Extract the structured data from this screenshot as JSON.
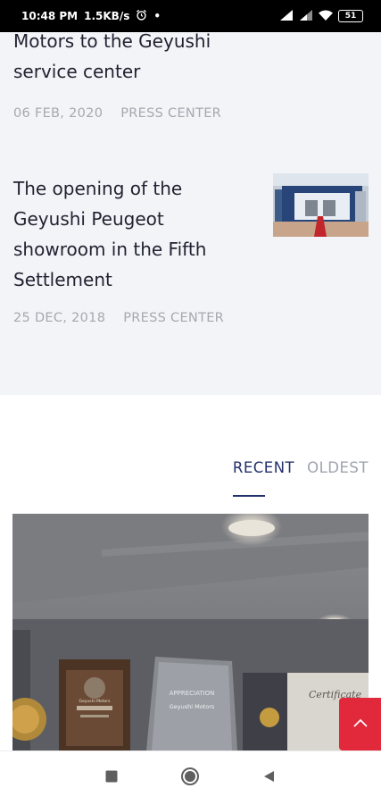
{
  "status_bar": {
    "time": "10:48 PM",
    "speed": "1.5KB/s",
    "dot": "•",
    "battery": "51"
  },
  "articles": [
    {
      "title_lines": [
        "Motors to the Geyushi",
        "service center"
      ],
      "date": "06 FEB, 2020",
      "category": "PRESS CENTER"
    },
    {
      "title_lines": [
        "The opening of the",
        "Geyushi Peugeot",
        "showroom in the Fifth",
        "Settlement"
      ],
      "date": "25 DEC, 2018",
      "category": "PRESS CENTER"
    }
  ],
  "tabs": {
    "recent": "RECENT",
    "oldest": "OLDEST"
  },
  "photo": {
    "plaque_text": "APPRECIATION",
    "plaque_sub": "Geyushi Motors",
    "cert_text": "Certificate",
    "plaque_left_text": "Geyushi Motors"
  },
  "colors": {
    "accent": "#23306b",
    "scroll_button": "#e2283b",
    "gray_section": "#f3f4f8"
  }
}
